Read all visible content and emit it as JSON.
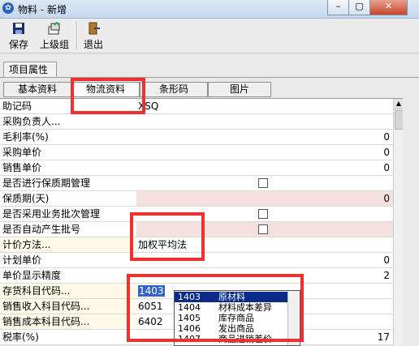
{
  "window": {
    "title": "物料 - 新增"
  },
  "toolbar": {
    "save_label": "保存",
    "parent_label": "上级组",
    "exit_label": "退出"
  },
  "group_tab": "项目属性",
  "tabs": [
    "基本资料",
    "物流资料",
    "条形码",
    "图片"
  ],
  "rows": [
    {
      "label": "助记码",
      "value": "XSQ"
    },
    {
      "label": "采购负责人...",
      "value": ""
    },
    {
      "label": "毛利率(%)",
      "value": "0"
    },
    {
      "label": "采购单价",
      "value": "0"
    },
    {
      "label": "销售单价",
      "value": "0"
    },
    {
      "label": "是否进行保质期管理",
      "value": ""
    },
    {
      "label": "保质期(天)",
      "value": "0"
    },
    {
      "label": "是否采用业务批次管理",
      "value": ""
    },
    {
      "label": "是否自动产生批号",
      "value": ""
    },
    {
      "label": "计价方法...",
      "value": "加权平均法"
    },
    {
      "label": "计划单价",
      "value": "0"
    },
    {
      "label": "单价显示精度",
      "value": "2"
    },
    {
      "label": "存货科目代码...",
      "value": "1403"
    },
    {
      "label": "销售收入科目代码...",
      "value": "6051"
    },
    {
      "label": "销售成本科目代码...",
      "value": "6402"
    },
    {
      "label": "税率(%)",
      "value": "17"
    }
  ],
  "dropdown": [
    {
      "code": "1403",
      "name": "原材料"
    },
    {
      "code": "1404",
      "name": "材料成本差异"
    },
    {
      "code": "1405",
      "name": "库存商品"
    },
    {
      "code": "1406",
      "name": "发出商品"
    },
    {
      "code": "1407",
      "name": "商品进销差价"
    }
  ]
}
